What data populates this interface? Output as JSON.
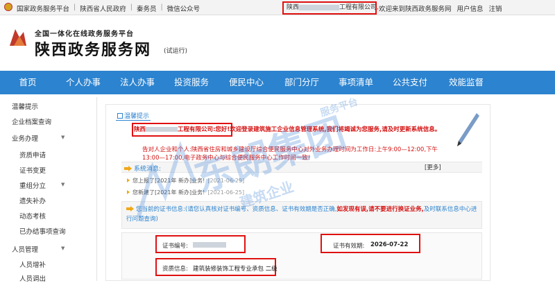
{
  "topbar": {
    "links": [
      "国家政务服务平台",
      "陕西省人民政府",
      "秦务员",
      "微信公众号"
    ],
    "user_prefix": "陕西",
    "user_suffix": "工程有限公司,",
    "welcome": "欢迎来到陕西政务服务网",
    "user_info": "用户信息",
    "logout": "注销"
  },
  "header": {
    "subtitle": "全国一体化在线政务服务平台",
    "title": "陕西政务服务网",
    "beta": "(试运行)"
  },
  "nav": {
    "items": [
      "首页",
      "个人办事",
      "法人办事",
      "投资服务",
      "便民中心",
      "部门分厅",
      "事项清单",
      "公共支付",
      "效能监督"
    ]
  },
  "sidebar": {
    "items": [
      {
        "label": "温馨提示",
        "sub": false
      },
      {
        "label": "企业档案查询",
        "sub": false
      },
      {
        "label": "业务办理",
        "sub": false,
        "caret": true
      },
      {
        "label": "资质申请",
        "sub": true
      },
      {
        "label": "证书变更",
        "sub": true
      },
      {
        "label": "重组分立",
        "sub": true,
        "caret": true
      },
      {
        "label": "遗失补办",
        "sub": true
      },
      {
        "label": "动态考核",
        "sub": true
      },
      {
        "label": "已办结事项查询",
        "sub": true
      },
      {
        "label": "人员管理",
        "sub": false,
        "caret": true
      },
      {
        "label": "人员增补",
        "sub": true
      },
      {
        "label": "人员调出",
        "sub": true
      }
    ]
  },
  "main": {
    "tab_label": "温馨提示",
    "welcome_prefix": "陕西",
    "welcome_company_suffix": "工程有限公司:",
    "welcome_text": "您好!欢迎登录建筑施工企业信息管理系统,我们将竭诚为您服务,请及时更新系统信息。",
    "notice_line1": "告对人企业和个人:陕西省住房和城乡建设厅综合便民服务中心对外业务办理时间为工作日:上午9:00—12:00,下午",
    "notice_line2": "13:00—17:00,电子政务中心与综合便民服务中心工作时间一致!",
    "system_msg_title": "系统消息:",
    "more": "[更多]",
    "messages": [
      {
        "text": "您上报了[2021年 新办]业务!",
        "date": "[2021-06-29]"
      },
      {
        "text": "您新建了[2021年 新办]业务!",
        "date": "[2021-06-25]"
      }
    ],
    "cert_notice_title": "您当前的证书信息:",
    "cert_notice_text": "(请您认真核对证书编号、资质信息、证书有效期是否正确,",
    "cert_notice_red": "如发现有误,请不要进行换证业务,",
    "cert_notice_tail": "及时联系信息中心进行问题查询)",
    "cert_no_label": "证书编号:",
    "cert_valid_label": "证书有效期:",
    "cert_valid_value": "2026-07-22",
    "qual_label": "资质信息:",
    "qual_value": "建筑装修装饰工程专业承包 二级"
  },
  "watermark": {
    "main": "东朗集团",
    "sub1": "建筑企业",
    "sub2": "服务平台"
  }
}
